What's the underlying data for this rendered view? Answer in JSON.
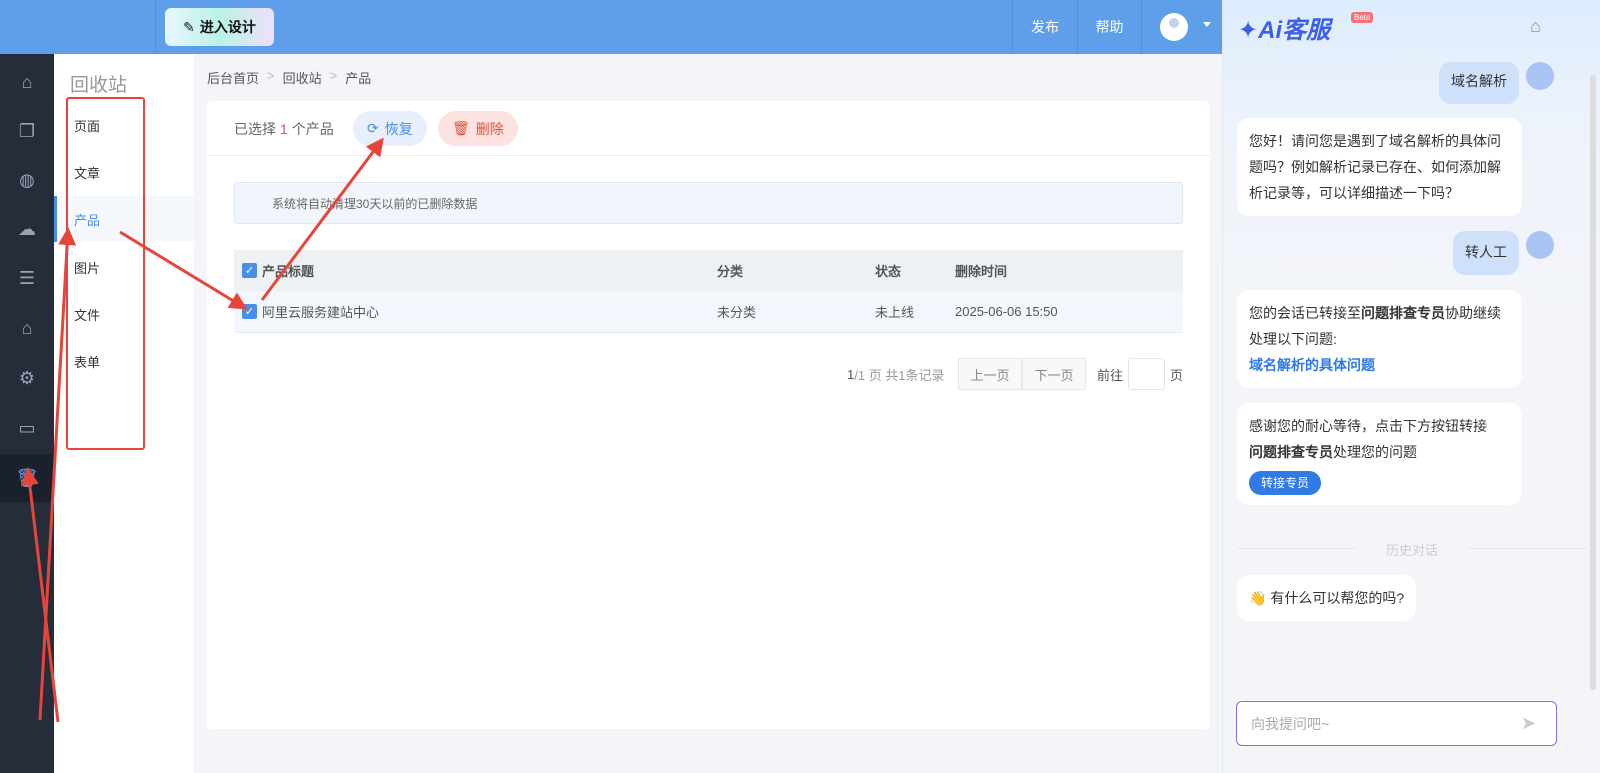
{
  "topbar": {
    "design_label": "进入设计",
    "publish": "发布",
    "help": "帮助"
  },
  "sidebar_icons": [
    "home-icon",
    "pages-icon",
    "planet-icon",
    "wechat-icon",
    "list-icon",
    "bag-icon",
    "gear-icon",
    "terminal-icon",
    "trash-icon"
  ],
  "submenu": {
    "title": "回收站",
    "items": [
      "页面",
      "文章",
      "产品",
      "图片",
      "文件",
      "表单"
    ],
    "active": 2
  },
  "breadcrumb": [
    "后台首页",
    "回收站",
    "产品"
  ],
  "toolbar": {
    "selected_prefix": "已选择",
    "selected_count": "1",
    "selected_suffix": "个产品",
    "restore": "恢复",
    "delete": "删除"
  },
  "notice": "系统将自动清理30天以前的已删除数据",
  "table": {
    "headers": [
      "产品标题",
      "分类",
      "状态",
      "删除时间"
    ],
    "rows": [
      {
        "title": "阿里云服务建站中心",
        "category": "未分类",
        "status": "未上线",
        "time": "2025-06-06 15:50"
      }
    ]
  },
  "pager": {
    "current": "1",
    "info": "/1 页 共1条记录",
    "prev": "上一页",
    "next": "下一页",
    "goto": "前往",
    "page_unit": "页"
  },
  "chat": {
    "logo": "Ai客服",
    "beta": "Beta",
    "msg1": "域名解析",
    "msg2": "您好！请问您是遇到了域名解析的具体问题吗？例如解析记录已存在、如何添加解析记录等，可以详细描述一下吗？",
    "msg3": "转人工",
    "msg4_a": "您的会话已转接至",
    "msg4_b": "问题排查专员",
    "msg4_c": "协助继续处理以下问题:",
    "msg4_link": "域名解析的具体问题",
    "msg5_a": "感谢您的耐心等待，点击下方按钮转接",
    "msg5_b": "问题排查专员",
    "msg5_c": "处理您的问题",
    "transfer": "转接专员",
    "history": "历史对话",
    "greet": "有什么可以帮您的吗?",
    "placeholder": "向我提问吧~"
  }
}
